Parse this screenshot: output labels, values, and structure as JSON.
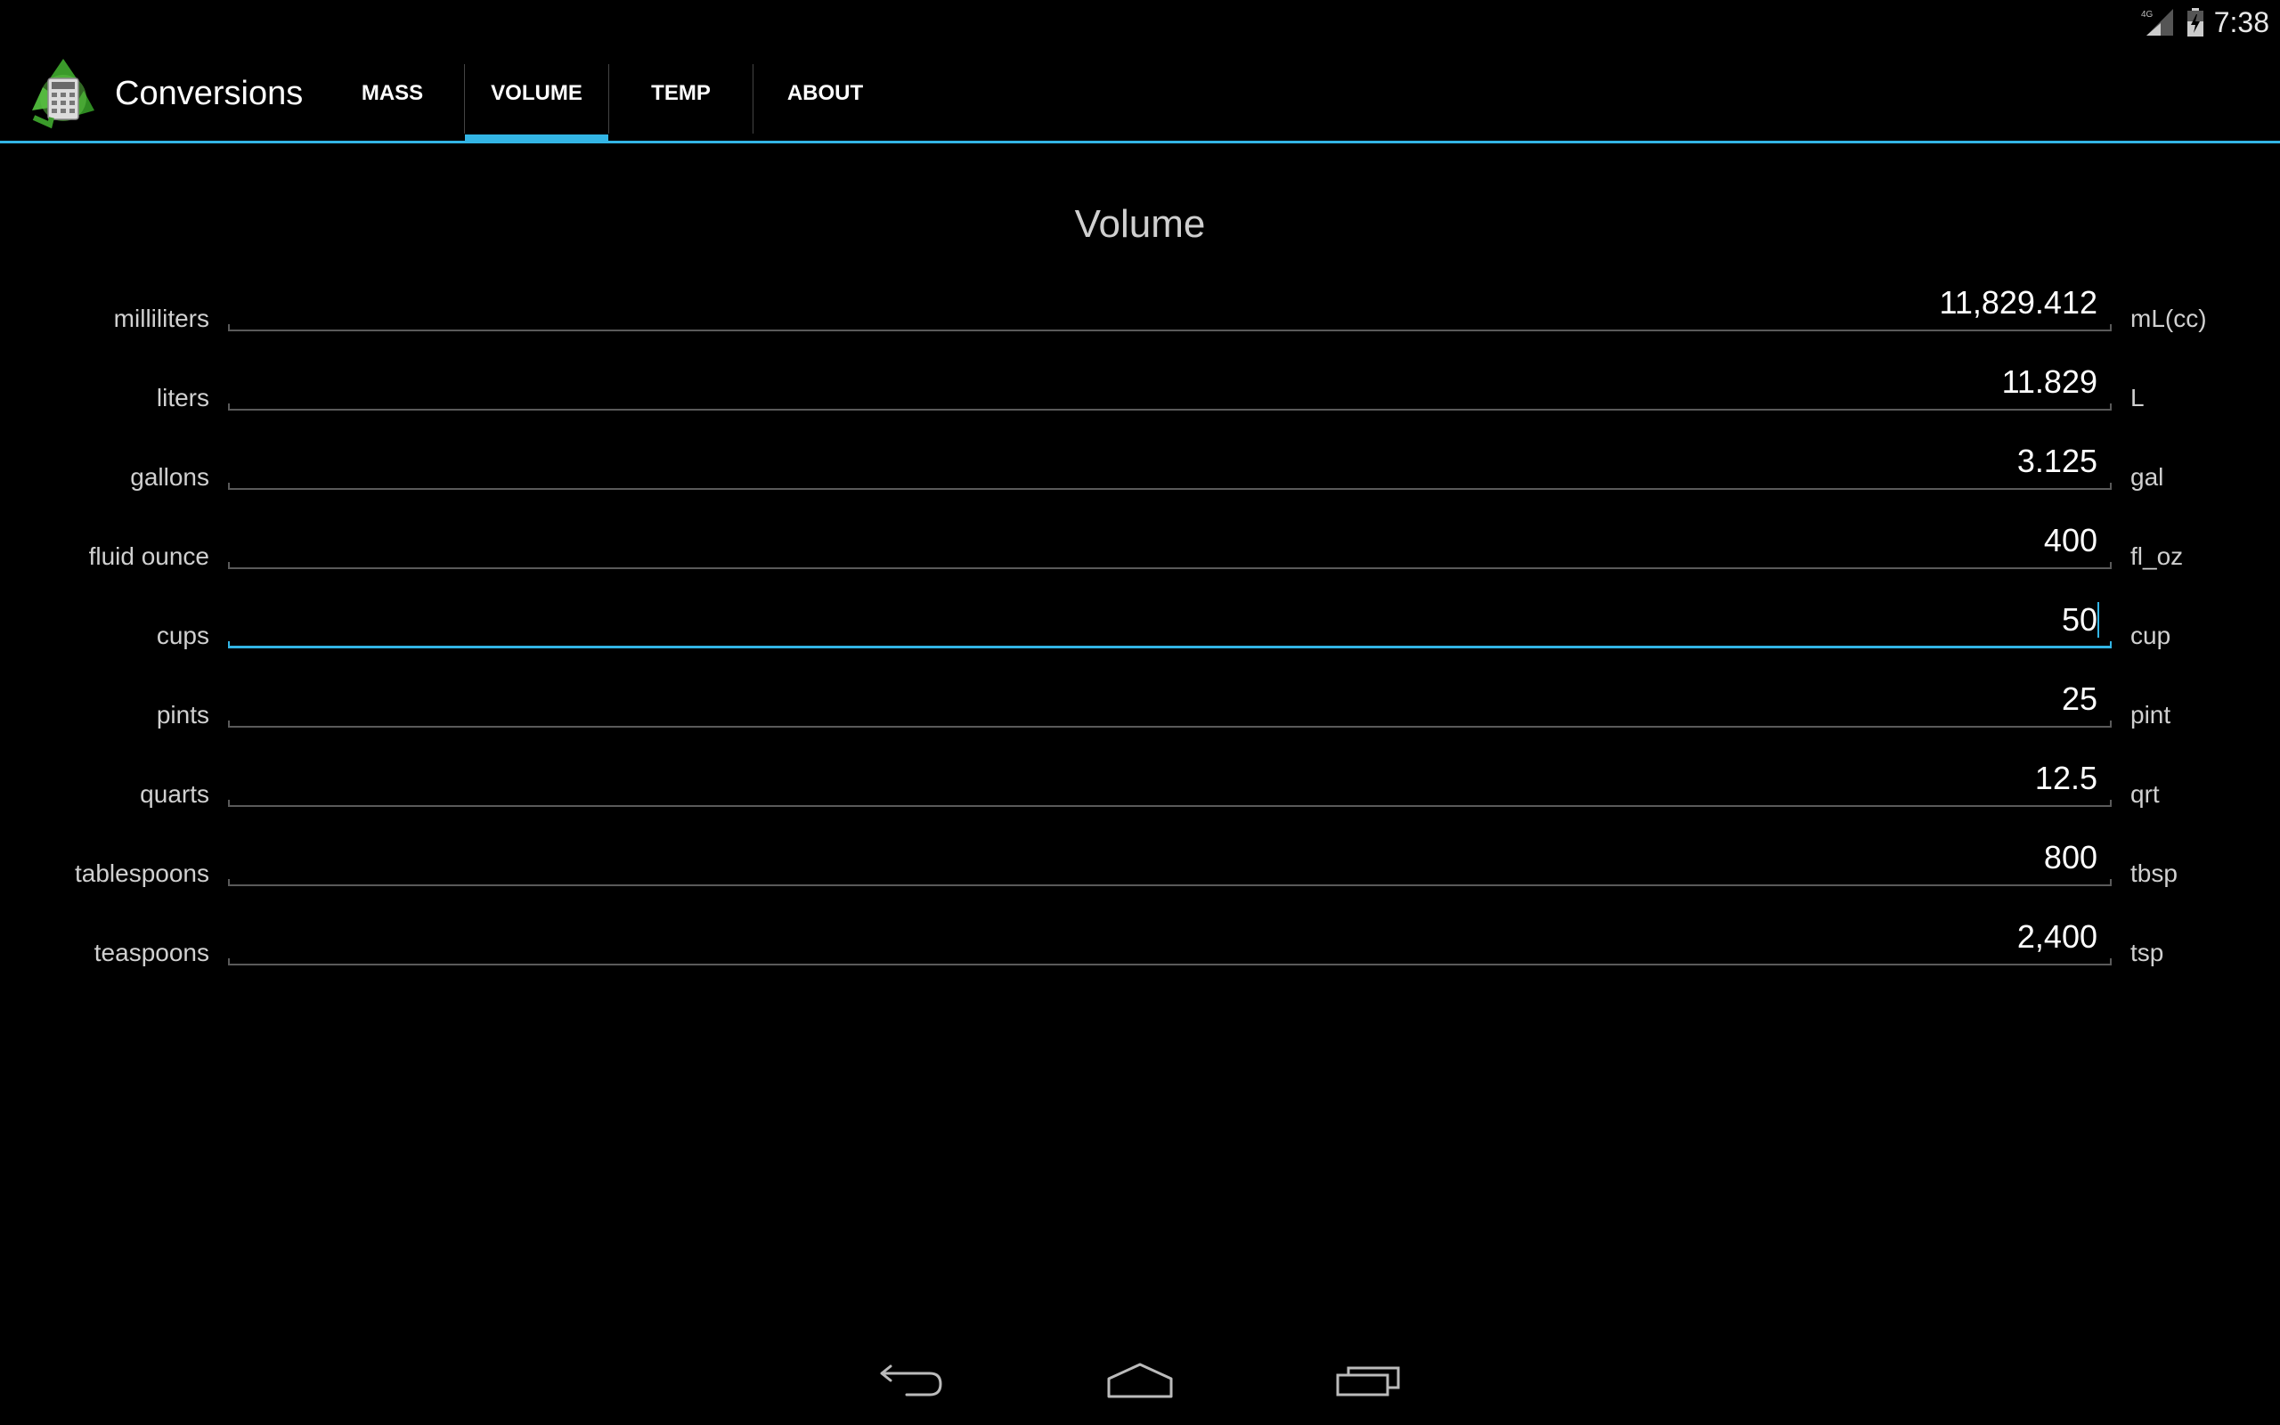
{
  "status_bar": {
    "network": "4G",
    "time": "7:38",
    "icons": [
      "signal-icon",
      "battery-icon"
    ]
  },
  "app": {
    "title": "Conversions",
    "icon": "recycle-calculator-icon",
    "accent_color": "#33b5e5"
  },
  "tabs": [
    {
      "label": "MASS",
      "active": false
    },
    {
      "label": "VOLUME",
      "active": true
    },
    {
      "label": "TEMP",
      "active": false
    },
    {
      "label": "ABOUT",
      "active": false
    }
  ],
  "content": {
    "title": "Volume",
    "rows": [
      {
        "label": "milliliters",
        "value": "11,829.412",
        "unit": "mL(cc)"
      },
      {
        "label": "liters",
        "value": "11.829",
        "unit": "L"
      },
      {
        "label": "gallons",
        "value": "3.125",
        "unit": "gal"
      },
      {
        "label": "fluid ounce",
        "value": "400",
        "unit": "fl_oz"
      },
      {
        "label": "cups",
        "value": "50",
        "unit": "cup",
        "focused": true
      },
      {
        "label": "pints",
        "value": "25",
        "unit": "pint"
      },
      {
        "label": "quarts",
        "value": "12.5",
        "unit": "qrt"
      },
      {
        "label": "tablespoons",
        "value": "800",
        "unit": "tbsp"
      },
      {
        "label": "teaspoons",
        "value": "2,400",
        "unit": "tsp"
      }
    ]
  },
  "nav_bar": {
    "buttons": [
      "back-icon",
      "home-icon",
      "recent-apps-icon"
    ]
  }
}
